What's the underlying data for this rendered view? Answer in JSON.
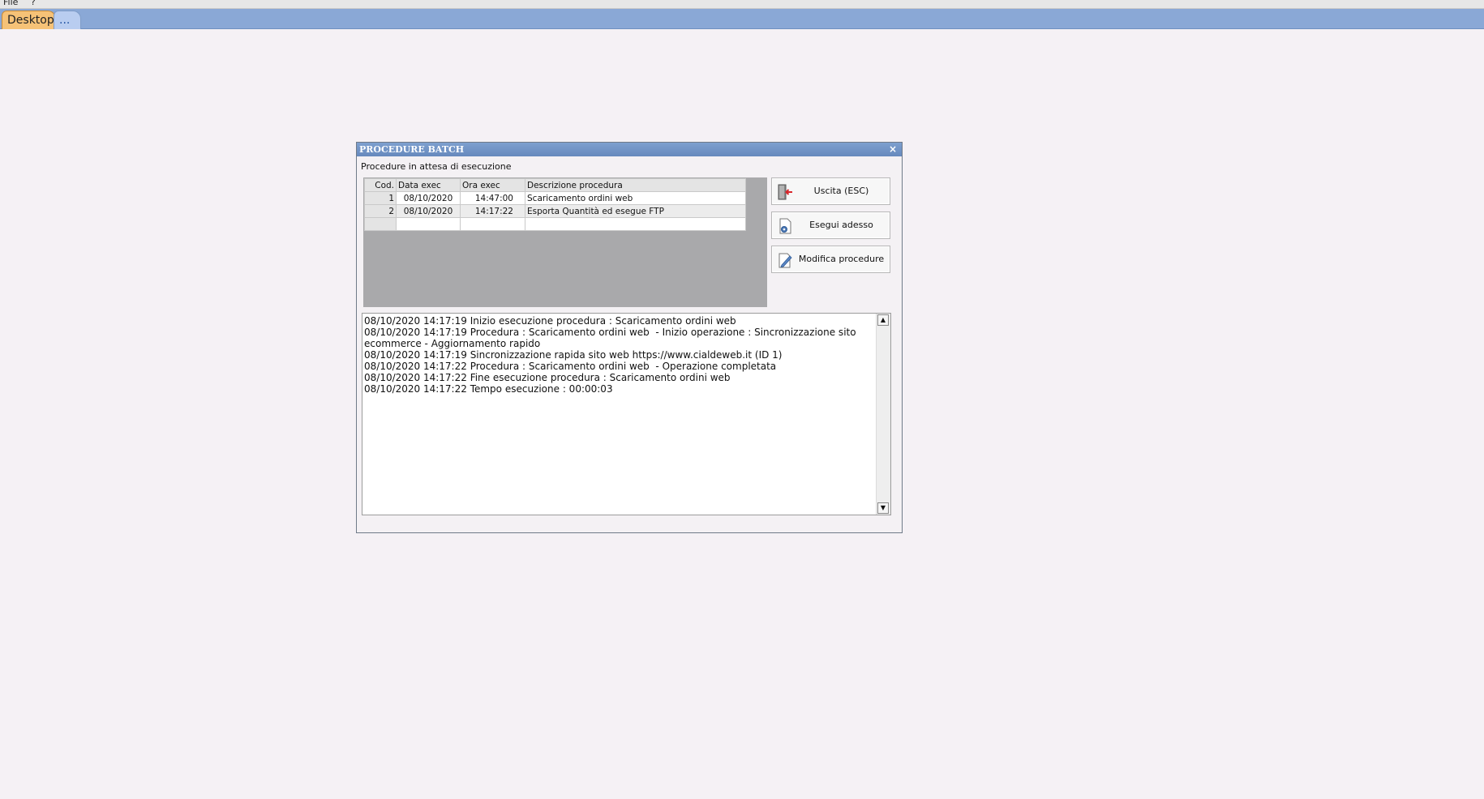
{
  "menu": {
    "file": "File",
    "help": "?"
  },
  "tabs": {
    "desktop": "Desktop",
    "more": "..."
  },
  "dialog": {
    "title": "PROCEDURE BATCH",
    "close_glyph": "×",
    "subtitle": "Procedure in attesa di esecuzione",
    "grid": {
      "headers": [
        "Cod.",
        "Data exec",
        "Ora exec",
        "Descrizione procedura"
      ],
      "rows": [
        {
          "cod": "1",
          "data": "08/10/2020",
          "ora": "14:47:00",
          "descr": "Scaricamento ordini web"
        },
        {
          "cod": "2",
          "data": "08/10/2020",
          "ora": "14:17:22",
          "descr": "Esporta Quantità ed esegue FTP"
        }
      ]
    },
    "buttons": {
      "exit": "Uscita (ESC)",
      "run_now": "Esegui adesso",
      "edit": "Modifica procedure"
    },
    "log": "08/10/2020 14:17:19 Inizio esecuzione procedura : Scaricamento ordini web\n08/10/2020 14:17:19 Procedura : Scaricamento ordini web  - Inizio operazione : Sincronizzazione sito ecommerce - Aggiornamento rapido\n08/10/2020 14:17:19 Sincronizzazione rapida sito web https://www.cialdeweb.it (ID 1)\n08/10/2020 14:17:22 Procedura : Scaricamento ordini web  - Operazione completata\n08/10/2020 14:17:22 Fine esecuzione procedura : Scaricamento ordini web\n08/10/2020 14:17:22 Tempo esecuzione : 00:00:03"
  },
  "icons": {
    "exit": "exit-door-icon",
    "run": "gear-document-icon",
    "edit": "pencil-document-icon",
    "scroll_up": "scroll-up-arrow-icon",
    "scroll_down": "scroll-down-arrow-icon"
  }
}
